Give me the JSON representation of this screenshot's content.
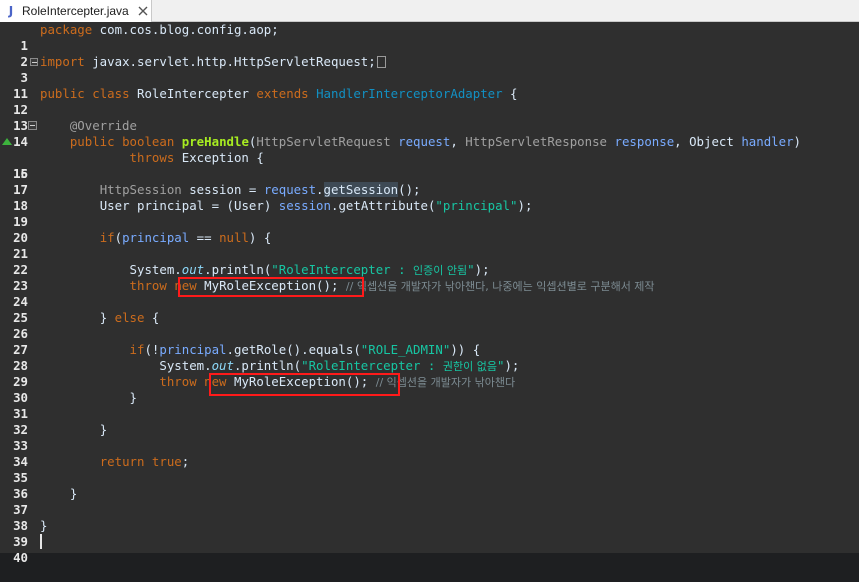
{
  "tab": {
    "icon": "java-file-icon",
    "icon_glyph": "J",
    "title": "RoleIntercepter.java",
    "close_icon": "close-icon"
  },
  "editor": {
    "lines": [
      {
        "num": "1"
      },
      {
        "num": "2"
      },
      {
        "num": "3"
      },
      {
        "num": "11"
      },
      {
        "num": "12"
      },
      {
        "num": "13"
      },
      {
        "num": "14"
      },
      {
        "num": "15"
      },
      {
        "num": "16"
      },
      {
        "num": "17"
      },
      {
        "num": "18"
      },
      {
        "num": "19"
      },
      {
        "num": "20"
      },
      {
        "num": "21"
      },
      {
        "num": "22"
      },
      {
        "num": "23"
      },
      {
        "num": "24"
      },
      {
        "num": "25"
      },
      {
        "num": "26"
      },
      {
        "num": "27"
      },
      {
        "num": "28"
      },
      {
        "num": "29"
      },
      {
        "num": "30"
      },
      {
        "num": "31"
      },
      {
        "num": "32"
      },
      {
        "num": "33"
      },
      {
        "num": "34"
      },
      {
        "num": "35"
      },
      {
        "num": "36"
      },
      {
        "num": "37"
      },
      {
        "num": "38"
      },
      {
        "num": "39"
      },
      {
        "num": "40"
      }
    ],
    "code": {
      "l1_kw": "package",
      "l1_rest": " com.cos.blog.config.aop;",
      "l3_kw": "import",
      "l3_rest": " javax.servlet.http.HttpServletRequest;",
      "l12_kw1": "public",
      "l12_kw2": "class",
      "l12_name": "RoleIntercepter",
      "l12_kw3": "extends",
      "l12_super": "HandlerInterceptorAdapter",
      "l12_brace": " {",
      "l14_ann": "@Override",
      "l15_kw1": "public",
      "l15_kw2": "boolean",
      "l15_fn": "preHandle",
      "l15_t1": "HttpServletRequest",
      "l15_p1": "request",
      "l15_t2": "HttpServletResponse",
      "l15_p2": "response",
      "l15_t3": "Object",
      "l15_p3": "handler",
      "l16_kw": "throws",
      "l16_rest": " Exception {",
      "l18_type": "HttpSession",
      "l18_var": "session",
      "l18_eq": " = ",
      "l18_obj": "request",
      "l18_call": "getSession",
      "l18_end": "();",
      "l19_type": "User",
      "l19_var": "principal",
      "l19_eq": " = (User) ",
      "l19_obj": "session",
      "l19_call": "getAttribute(",
      "l19_str": "\"principal\"",
      "l19_end": ");",
      "l21_kw": "if",
      "l21_var": "principal",
      "l21_op": " == ",
      "l21_null": "null",
      "l21_end": ") {",
      "l23_sys": "System.",
      "l23_out": "out",
      "l23_call": ".println(",
      "l23_str": "\"RoleIntercepter : ",
      "l23_ko": "인증이 안됨",
      "l23_q": "\"",
      "l23_end": ");",
      "l24_kw1": "throw",
      "l24_kw2": "new",
      "l24_ctor": " MyRoleException();",
      "l24_cm": "// 익셉션을 개발자가 낚아챈다, 나중에는 익셉션별로 구분해서 제작",
      "l26_brace": "} ",
      "l26_kw": "else",
      "l26_end": " {",
      "l28_kw": "if",
      "l28_bang": "(!",
      "l28_var": "principal",
      "l28_call": ".getRole().equals(",
      "l28_str": "\"ROLE_ADMIN\"",
      "l28_end": ")) {",
      "l29_sys": "System.",
      "l29_out": "out",
      "l29_call": ".println(",
      "l29_str": "\"RoleIntercepter : ",
      "l29_ko": "권한이 없음",
      "l29_q": "\"",
      "l29_end": ");",
      "l30_kw1": "throw",
      "l30_kw2": "new",
      "l30_ctor": " MyRoleException();",
      "l30_cm": "// 익셉션을 개발자가 낚아챈다",
      "l31_brace": "}",
      "l33_brace": "}",
      "l35_kw": "return",
      "l35_val": "true",
      "l35_end": ";",
      "l37_brace": "}",
      "l39_brace": "}"
    }
  }
}
